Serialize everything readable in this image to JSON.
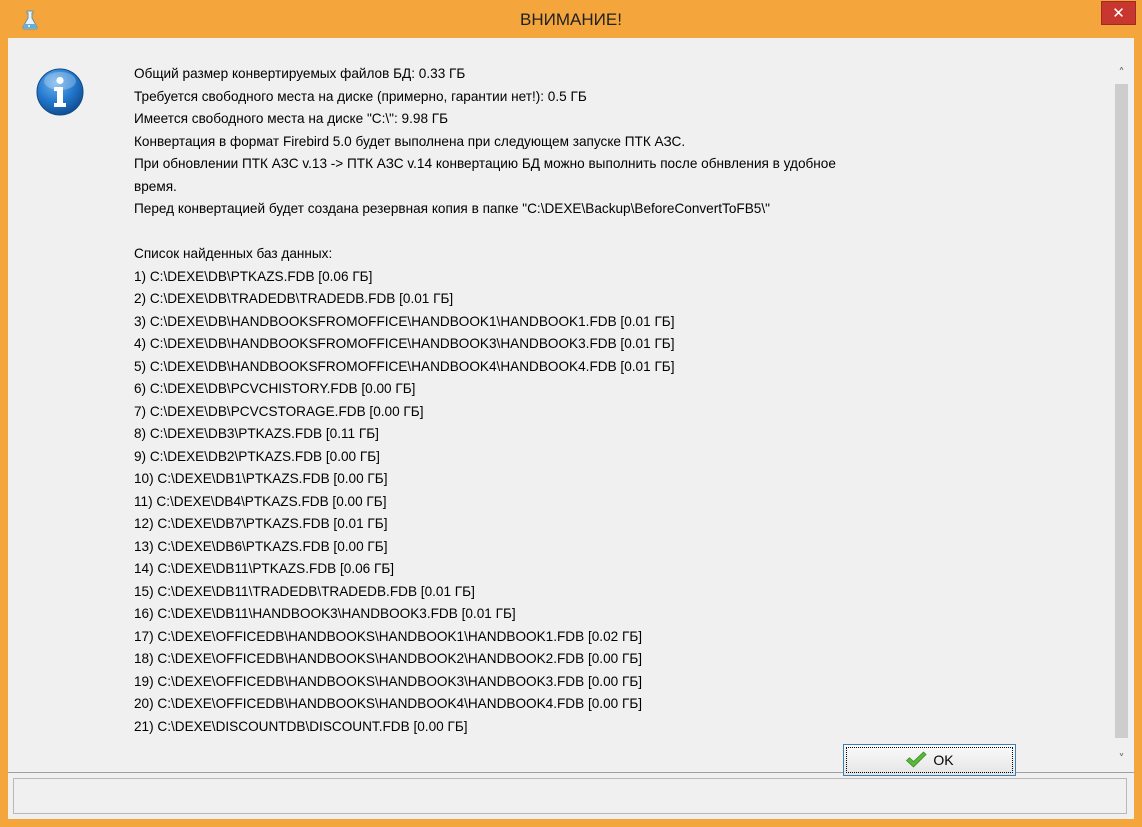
{
  "window": {
    "title": "ВНИМАНИЕ!",
    "close_glyph": "✕",
    "app_icon": "flask-icon",
    "colors": {
      "titlebar": "#f4a63c",
      "close_button": "#c7362f",
      "client": "#f0f0f0",
      "info_icon": "#1e6fbf"
    }
  },
  "dialog": {
    "icon": "info-icon",
    "lines": [
      "Общий размер конвертируемых файлов БД: 0.33 ГБ",
      "Требуется свободного места на диске (примерно, гарантии нет!): 0.5 ГБ",
      "Имеется свободного места на диске \"C:\\\": 9.98 ГБ",
      "Конвертация в формат Firebird 5.0 будет выполнена при следующем запуске ПТК АЗС.",
      "При обновлении ПТК АЗС v.13 -> ПТК АЗС v.14 конвертацию БД можно выполнить после обнвления в удобное",
      "время.",
      "Перед конвертацией будет создана резервная копия в папке \"C:\\DEXE\\Backup\\BeforeConvertToFB5\\\"",
      "",
      "Список найденных баз данных:",
      "1) C:\\DEXE\\DB\\PTKAZS.FDB [0.06 ГБ]",
      "2) C:\\DEXE\\DB\\TRADEDB\\TRADEDB.FDB [0.01 ГБ]",
      "3) C:\\DEXE\\DB\\HANDBOOKSFROMOFFICE\\HANDBOOK1\\HANDBOOK1.FDB [0.01 ГБ]",
      "4) C:\\DEXE\\DB\\HANDBOOKSFROMOFFICE\\HANDBOOK3\\HANDBOOK3.FDB [0.01 ГБ]",
      "5) C:\\DEXE\\DB\\HANDBOOKSFROMOFFICE\\HANDBOOK4\\HANDBOOK4.FDB [0.01 ГБ]",
      "6) C:\\DEXE\\DB\\PCVCHISTORY.FDB [0.00 ГБ]",
      "7) C:\\DEXE\\DB\\PCVCSTORAGE.FDB [0.00 ГБ]",
      "8) C:\\DEXE\\DB3\\PTKAZS.FDB [0.11 ГБ]",
      "9) C:\\DEXE\\DB2\\PTKAZS.FDB [0.00 ГБ]",
      "10) C:\\DEXE\\DB1\\PTKAZS.FDB [0.00 ГБ]",
      "11) C:\\DEXE\\DB4\\PTKAZS.FDB [0.00 ГБ]",
      "12) C:\\DEXE\\DB7\\PTKAZS.FDB [0.01 ГБ]",
      "13) C:\\DEXE\\DB6\\PTKAZS.FDB [0.00 ГБ]",
      "14) C:\\DEXE\\DB11\\PTKAZS.FDB [0.06 ГБ]",
      "15) C:\\DEXE\\DB11\\TRADEDB\\TRADEDB.FDB [0.01 ГБ]",
      "16) C:\\DEXE\\DB11\\HANDBOOK3\\HANDBOOK3.FDB [0.01 ГБ]",
      "17) C:\\DEXE\\OFFICEDB\\HANDBOOKS\\HANDBOOK1\\HANDBOOK1.FDB [0.02 ГБ]",
      "18) C:\\DEXE\\OFFICEDB\\HANDBOOKS\\HANDBOOK2\\HANDBOOK2.FDB [0.00 ГБ]",
      "19) C:\\DEXE\\OFFICEDB\\HANDBOOKS\\HANDBOOK3\\HANDBOOK3.FDB [0.00 ГБ]",
      "20) C:\\DEXE\\OFFICEDB\\HANDBOOKS\\HANDBOOK4\\HANDBOOK4.FDB [0.00 ГБ]",
      "21) C:\\DEXE\\DISCOUNTDB\\DISCOUNT.FDB [0.00 ГБ]"
    ]
  },
  "scrollbar": {
    "up_glyph": "˄",
    "down_glyph": "˅"
  },
  "footer": {
    "ok_label": "OK",
    "ok_icon": "checkmark-icon"
  }
}
